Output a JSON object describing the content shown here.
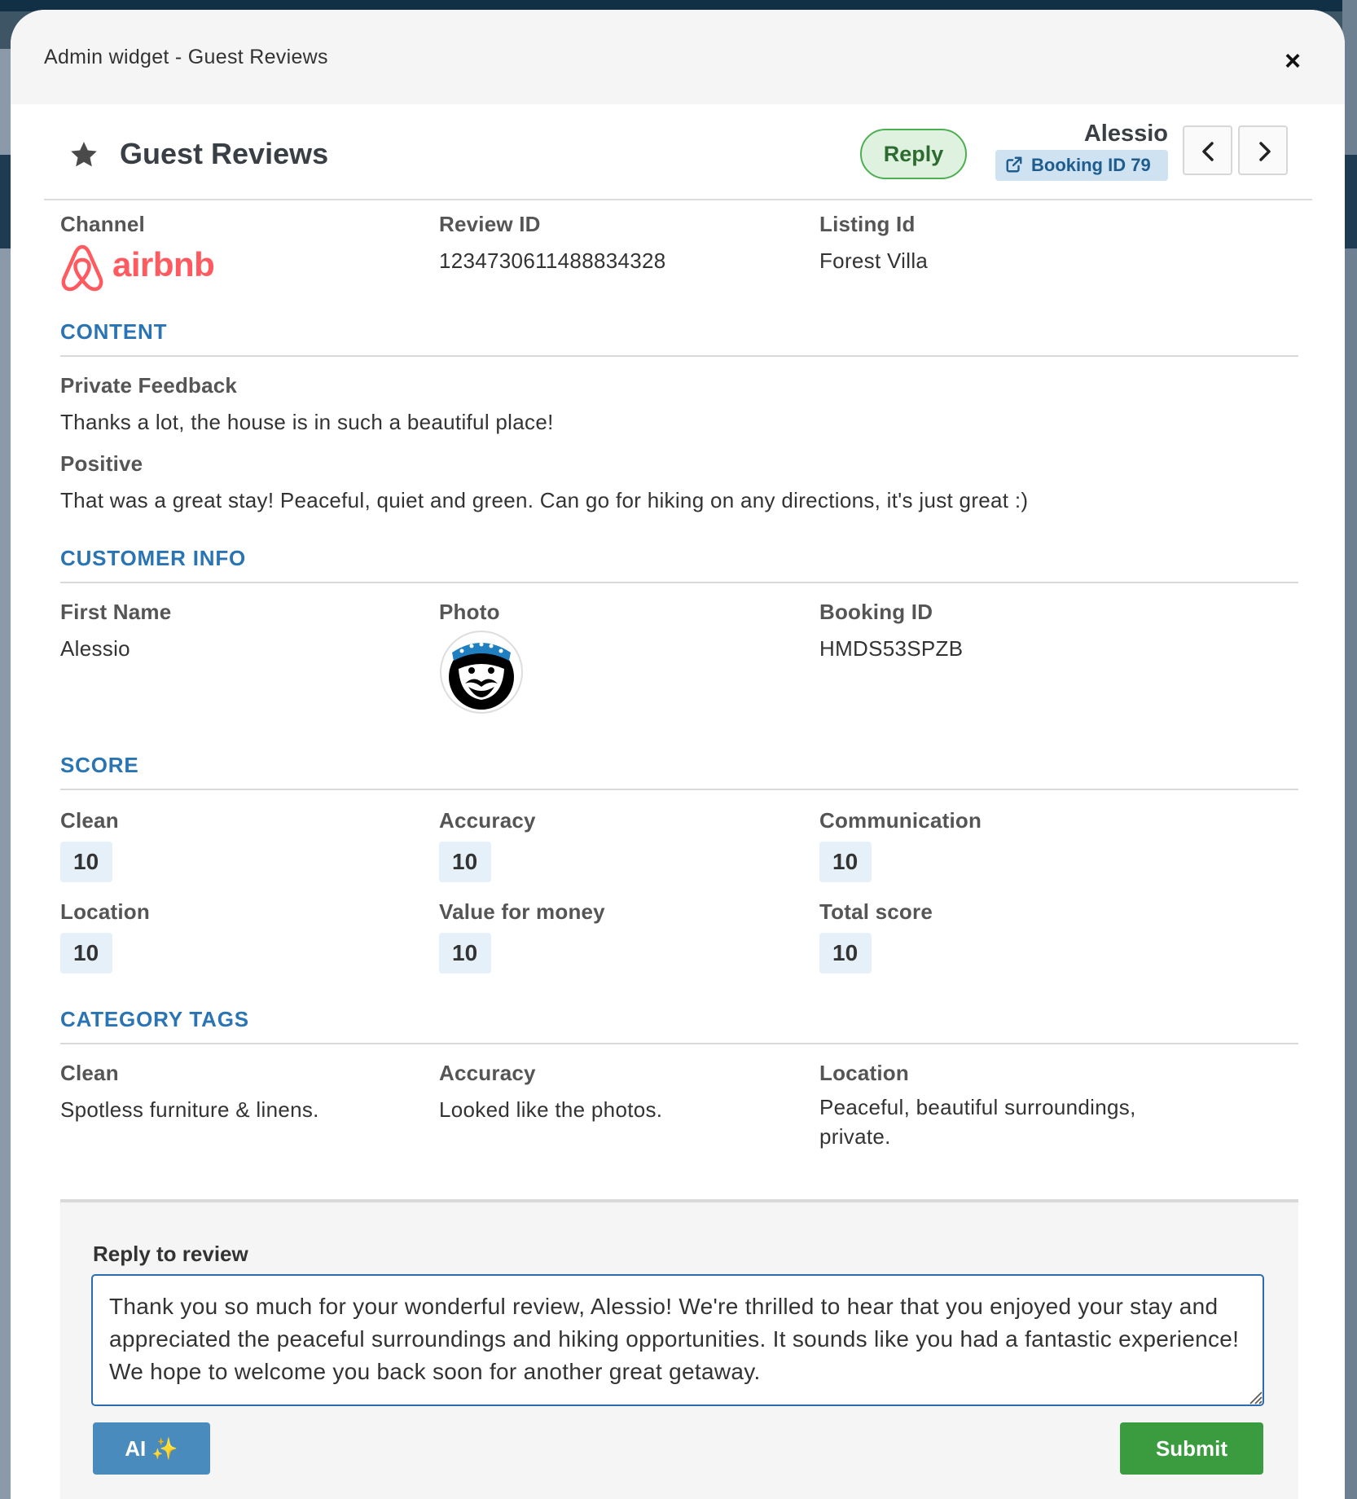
{
  "modal": {
    "title": "Admin widget - Guest Reviews",
    "close_symbol": "×"
  },
  "header": {
    "heading": "Guest Reviews",
    "reply_label": "Reply",
    "guest_name": "Alessio",
    "booking_link": "Booking ID 79"
  },
  "overview": {
    "channel_label": "Channel",
    "channel_name": "airbnb",
    "review_id_label": "Review ID",
    "review_id": "1234730611488834328",
    "listing_label": "Listing Id",
    "listing_value": "Forest Villa"
  },
  "content": {
    "section_title": "CONTENT",
    "private_label": "Private Feedback",
    "private_text": "Thanks a lot, the house is in such a beautiful place!",
    "positive_label": "Positive",
    "positive_text": "That was a great stay! Peaceful, quiet and green. Can go for hiking on any directions, it's just great :)"
  },
  "customer": {
    "section_title": "CUSTOMER INFO",
    "first_name_label": "First Name",
    "first_name": "Alessio",
    "photo_label": "Photo",
    "booking_label": "Booking ID",
    "booking_value": "HMDS53SPZB"
  },
  "score": {
    "section_title": "SCORE",
    "items": [
      {
        "label": "Clean",
        "value": "10"
      },
      {
        "label": "Accuracy",
        "value": "10"
      },
      {
        "label": "Communication",
        "value": "10"
      },
      {
        "label": "Location",
        "value": "10"
      },
      {
        "label": "Value for money",
        "value": "10"
      },
      {
        "label": "Total score",
        "value": "10"
      }
    ]
  },
  "tags": {
    "section_title": "CATEGORY TAGS",
    "items": [
      {
        "label": "Clean",
        "text": "Spotless furniture & linens."
      },
      {
        "label": "Accuracy",
        "text": "Looked like the photos."
      },
      {
        "label": "Location",
        "text": "Peaceful, beautiful surroundings, private."
      }
    ]
  },
  "reply": {
    "label": "Reply to review",
    "text": "Thank you so much for your wonderful review, Alessio! We're thrilled to hear that you enjoyed your stay and appreciated the peaceful surroundings and hiking opportunities. It sounds like you had a fantastic experience! We hope to welcome you back soon for another great getaway.",
    "ai_label": "AI ✨",
    "submit_label": "Submit"
  },
  "colors": {
    "accent_blue": "#2a74b4",
    "airbnb": "#ff5a5f",
    "submit_green": "#3a9b3f",
    "ai_blue": "#4a8bbd"
  }
}
